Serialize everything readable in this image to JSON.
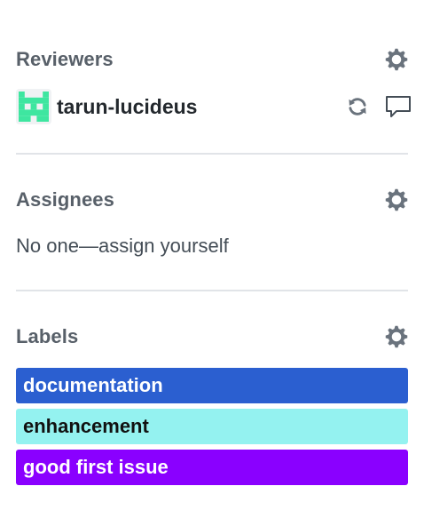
{
  "reviewers": {
    "title": "Reviewers",
    "items": [
      {
        "name": "tarun-lucideus"
      }
    ]
  },
  "assignees": {
    "title": "Assignees",
    "empty_prefix": "No one—",
    "assign_self": "assign yourself"
  },
  "labels": {
    "title": "Labels",
    "items": [
      {
        "name": "documentation",
        "bg": "#2b5fd0",
        "fg": "#ffffff"
      },
      {
        "name": "enhancement",
        "bg": "#94f2f0",
        "fg": "#111111"
      },
      {
        "name": "good first issue",
        "bg": "#8a00ff",
        "fg": "#ffffff"
      }
    ]
  },
  "colors": {
    "icon": "#6a737d",
    "divider": "#e1e4e8",
    "avatar_green": "#3ee6a0"
  },
  "icons": [
    "gear-icon",
    "sync-icon",
    "comment-icon"
  ]
}
